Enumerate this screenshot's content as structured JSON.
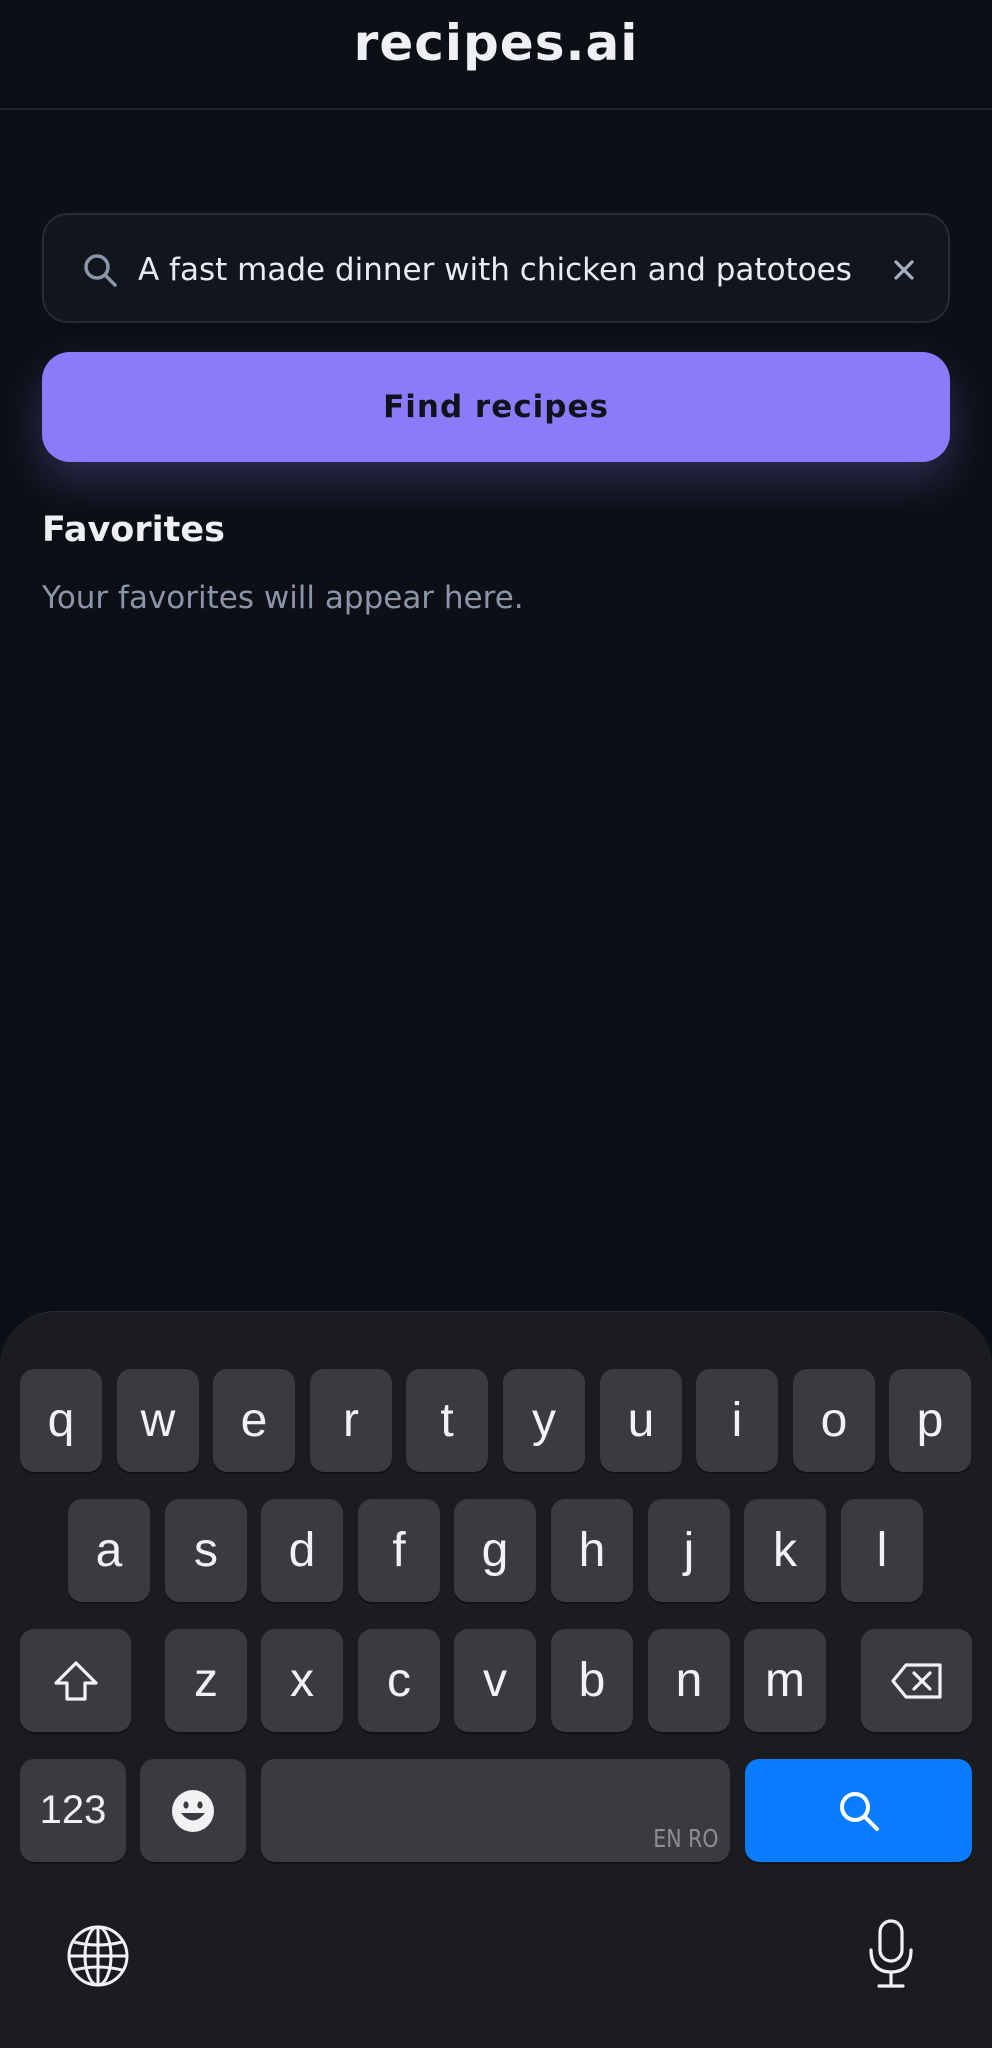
{
  "header": {
    "title": "recipes.ai"
  },
  "search": {
    "value": "A fast made dinner with chicken and patotoes",
    "icon": "search-icon",
    "clear_icon": "close-icon"
  },
  "find_button": {
    "label": "Find recipes",
    "color": "#8a7cf9"
  },
  "favorites": {
    "title": "Favorites",
    "empty_text": "Your favorites will appear here."
  },
  "keyboard": {
    "row1": [
      "q",
      "w",
      "e",
      "r",
      "t",
      "y",
      "u",
      "i",
      "o",
      "p"
    ],
    "row2": [
      "a",
      "s",
      "d",
      "f",
      "g",
      "h",
      "j",
      "k",
      "l"
    ],
    "row3": [
      "z",
      "x",
      "c",
      "v",
      "b",
      "n",
      "m"
    ],
    "numbers_label": "123",
    "space_language": "EN RO",
    "search_key_color": "#0a7cff",
    "icons": [
      "shift-icon",
      "backspace-icon",
      "emoji-icon",
      "search-icon",
      "globe-icon",
      "microphone-icon"
    ]
  }
}
